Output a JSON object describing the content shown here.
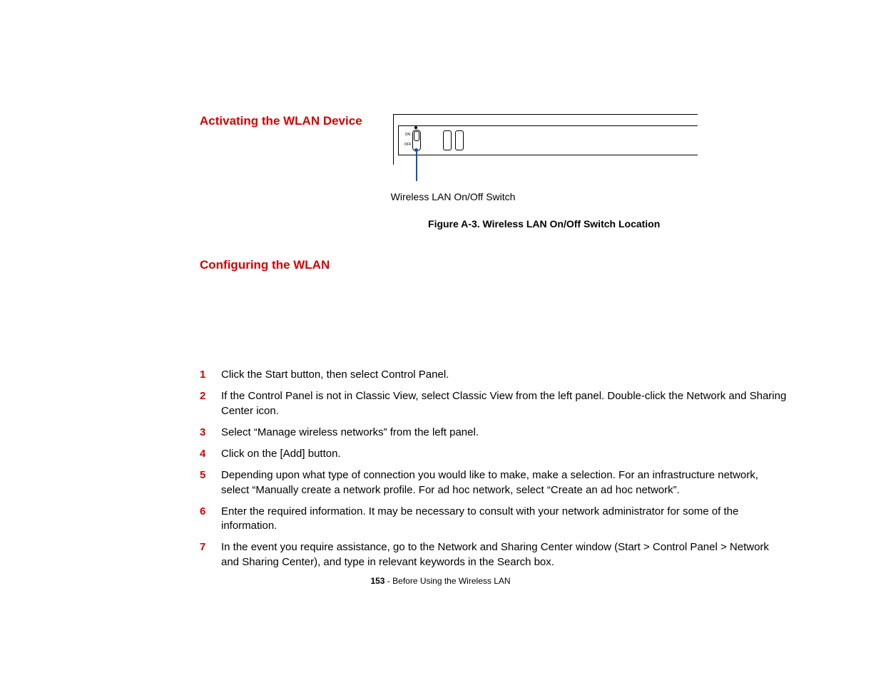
{
  "headings": {
    "activating": "Activating the WLAN Device",
    "configuring": "Configuring the WLAN"
  },
  "figure": {
    "switch_on": "ON",
    "switch_off": "OFF",
    "callout": "Wireless LAN On/Off Switch",
    "caption": "Figure A-3. Wireless LAN On/Off Switch Location"
  },
  "steps": [
    "Click the Start button, then select Control Panel.",
    "If the Control Panel is not in Classic View, select Classic View from the left panel. Double-click the Network and Sharing Center icon.",
    "Select “Manage wireless networks” from the left panel.",
    "Click on the [Add] button.",
    "Depending upon what type of connection you would like to make, make a selection. For an infrastructure network, select “Manually create a network profile. For ad hoc network, select “Create an ad hoc network”.",
    "Enter the required information. It may be necessary to consult with your network administrator for some of the information.",
    "In the event you require assistance, go to the Network and Sharing Center window (Start > Control Panel > Network and Sharing Center), and type in relevant keywords in the Search box."
  ],
  "footer": {
    "page": "153",
    "sep": " - ",
    "title": "Before Using the Wireless LAN"
  }
}
